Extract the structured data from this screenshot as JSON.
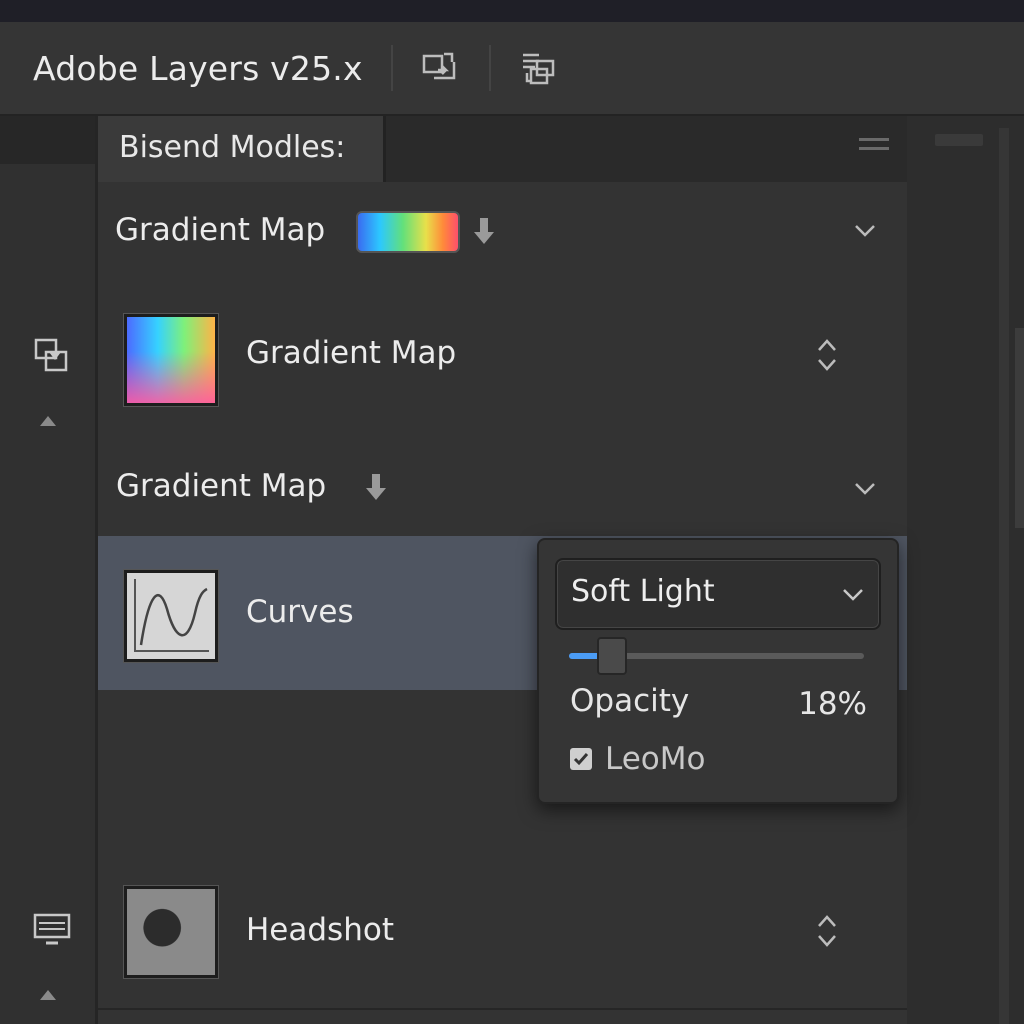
{
  "app": {
    "title": "Adobe Layers v25.x"
  },
  "panel": {
    "tab_label": "Bisend Modles:"
  },
  "rows": [
    {
      "label": "Gradient Map"
    },
    {
      "label": "Gradient Map"
    },
    {
      "label": "Gradient Map"
    },
    {
      "label": "Curves"
    },
    {
      "label": "Headshot"
    }
  ],
  "popup": {
    "blend_mode": "Soft Light",
    "opacity_label": "Opacity",
    "opacity_value": "18%",
    "opacity_fraction": 0.14,
    "checkbox_label": "LeoMo",
    "checkbox_checked": true
  },
  "colors": {
    "accent": "#4b9cf5",
    "selected_row": "#4f5561"
  },
  "icons": {
    "title_a": "layer-swap-icon",
    "title_b": "layer-stack-icon",
    "rail_top": "layer-mask-icon",
    "rail_bottom": "monitor-icon"
  }
}
